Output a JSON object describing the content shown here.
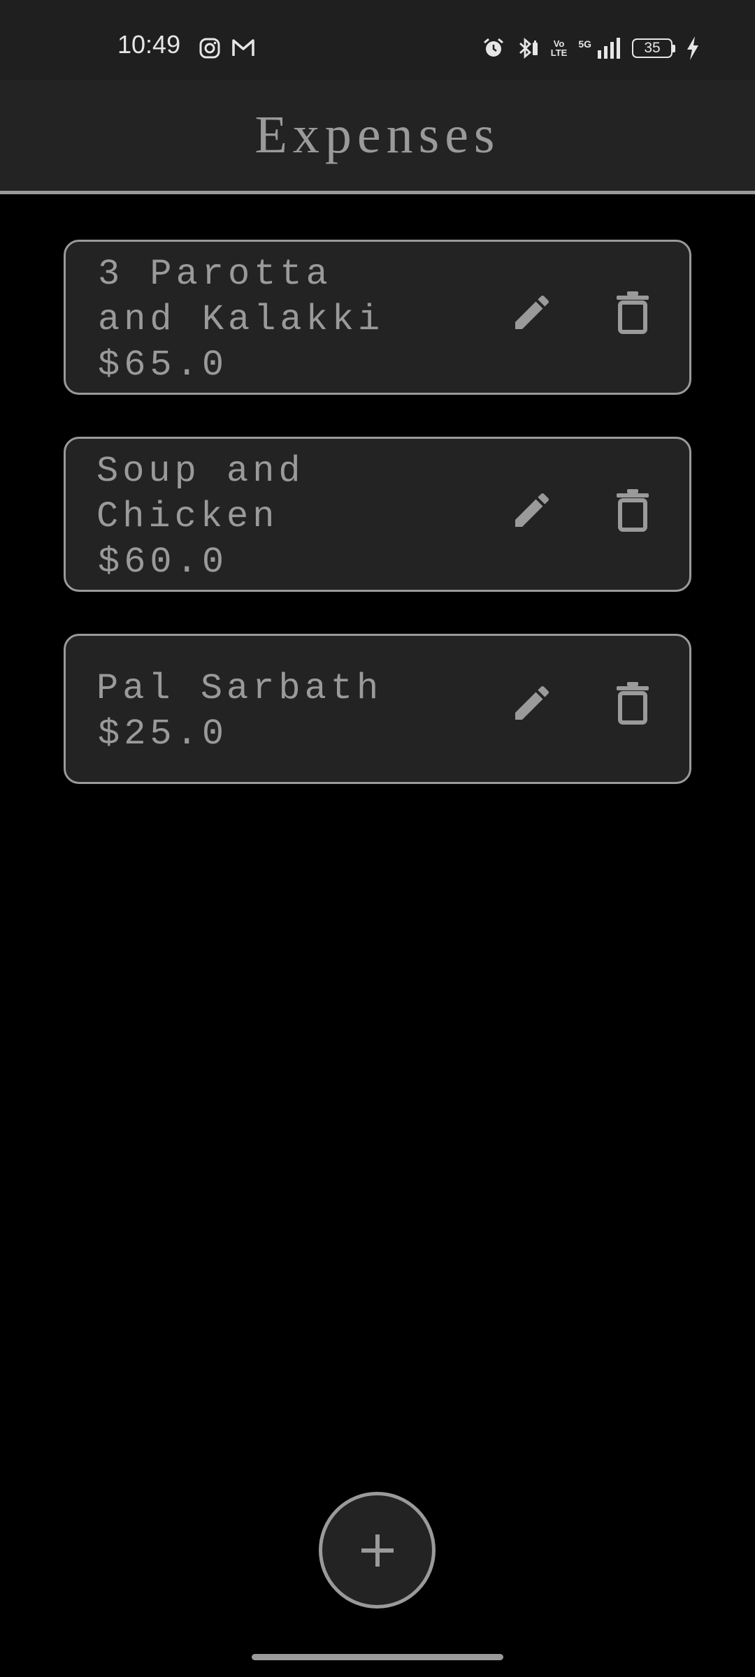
{
  "status_bar": {
    "time": "10:49",
    "left_icons": [
      "instagram-icon",
      "gmail-icon"
    ],
    "right_icons": [
      "alarm-icon",
      "bluetooth-icon",
      "volte-icon",
      "5g-icon",
      "signal-icon",
      "battery-icon",
      "charging-icon"
    ],
    "volte_top": "Vo",
    "volte_bottom": "LTE",
    "network": "5G",
    "battery": "35"
  },
  "app_bar": {
    "title": "Expenses"
  },
  "expenses": [
    {
      "name": "3 Parotta\nand Kalakki",
      "amount": "$65.0"
    },
    {
      "name": "Soup and\nChicken",
      "amount": "$60.0"
    },
    {
      "name": "Pal Sarbath",
      "amount": "$25.0"
    }
  ],
  "actions": {
    "edit_icon": "pencil-icon",
    "delete_icon": "trash-icon",
    "add_icon": "plus-icon"
  },
  "colors": {
    "background": "#000000",
    "surface": "#232323",
    "foreground": "#9a9a9a"
  }
}
